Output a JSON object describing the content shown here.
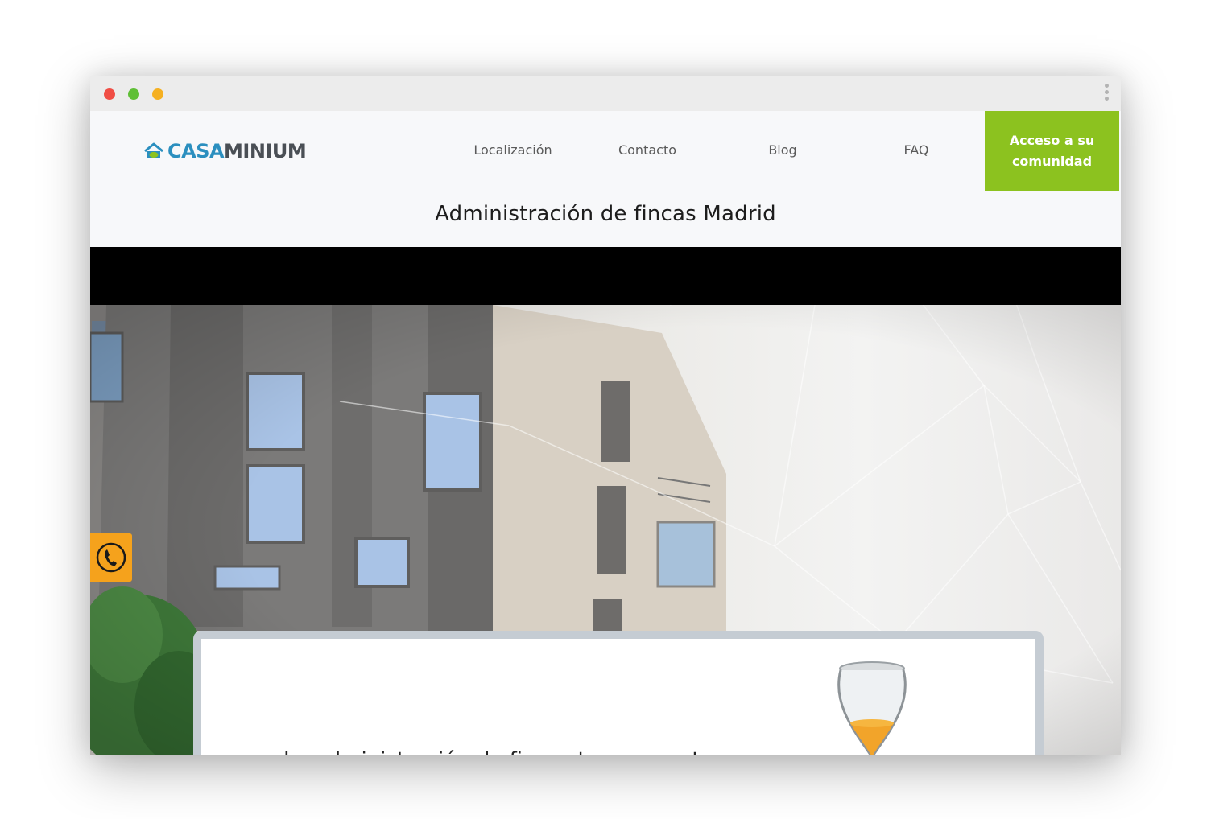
{
  "window": {
    "controls": [
      "close",
      "minimize",
      "maximize"
    ],
    "menu_icon": "kebab-menu-icon"
  },
  "nav": {
    "logo": {
      "part1": "CASA",
      "part2": "MINIUM",
      "icon": "house-icon"
    },
    "links": [
      "Localización",
      "Contacto",
      "Blog",
      "FAQ"
    ],
    "cta": "Acceso a su comunidad"
  },
  "hero": {
    "heading": "Administración de fincas Madrid",
    "phone_icon": "phone-icon",
    "card_text": "La administración de fincas transparente"
  },
  "colors": {
    "accent_green": "#8cc21f",
    "logo_blue": "#2b8fbf",
    "phone_orange": "#f5a21c"
  }
}
